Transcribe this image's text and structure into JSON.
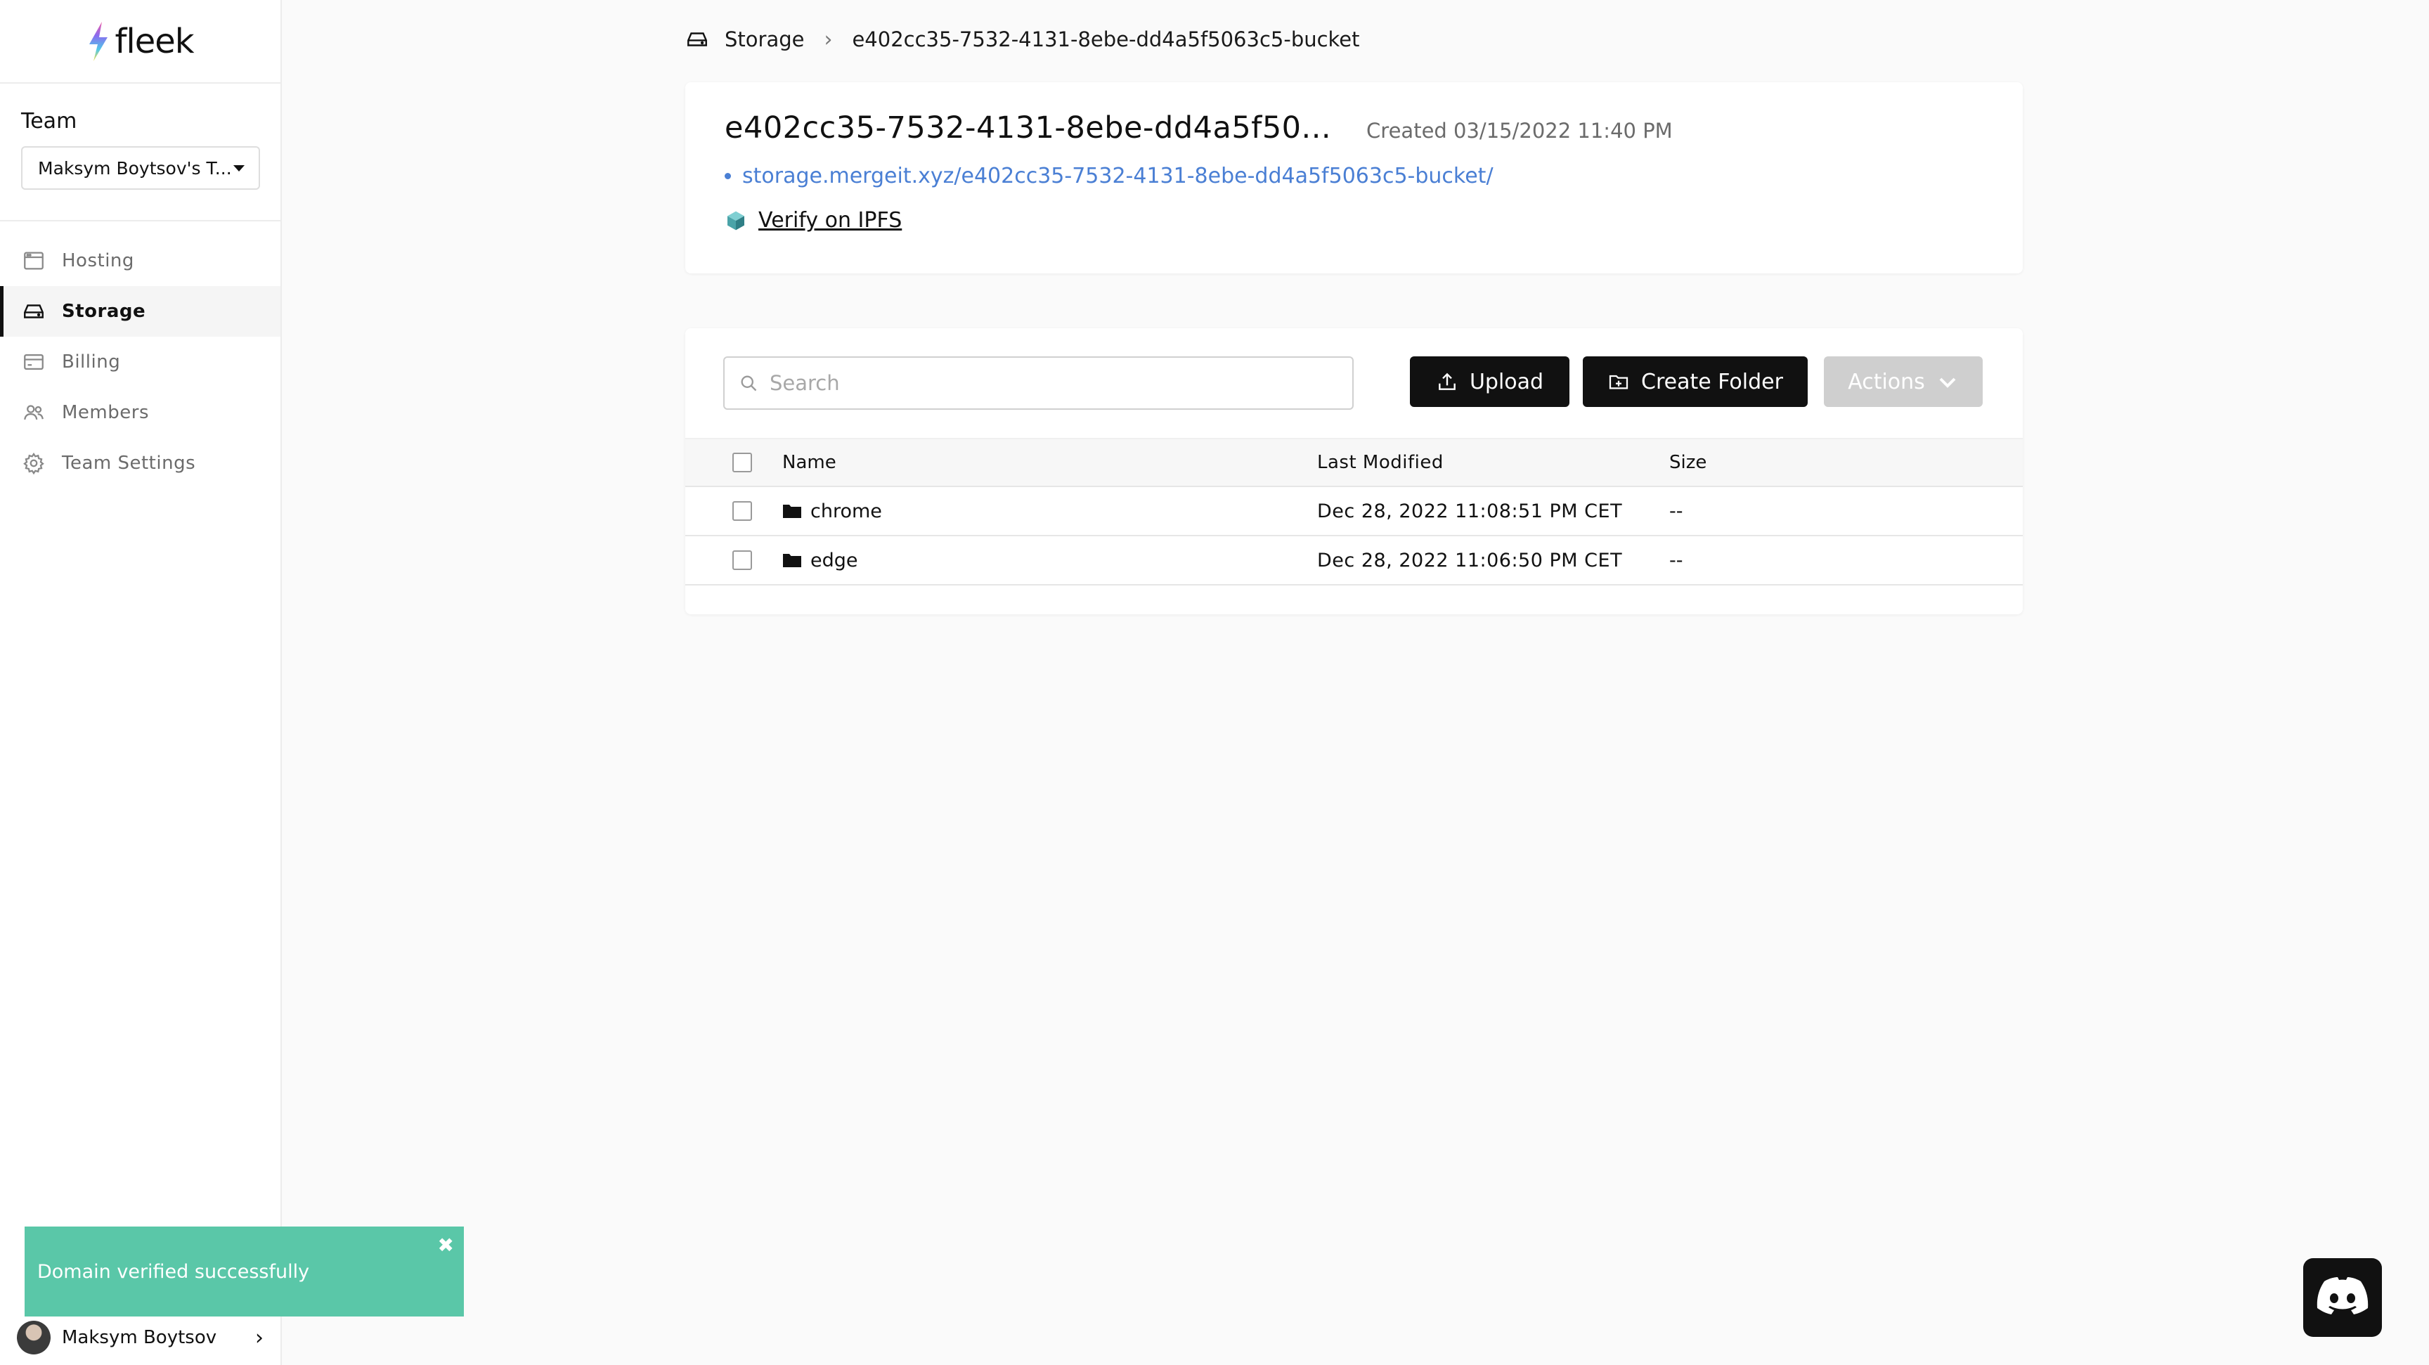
{
  "app": {
    "name": "fleek"
  },
  "sidebar": {
    "team_label": "Team",
    "team_select": "Maksym Boytsov's T...",
    "items": [
      {
        "label": "Hosting",
        "icon": "browser-window-icon",
        "active": false
      },
      {
        "label": "Storage",
        "icon": "hard-drive-icon",
        "active": true
      },
      {
        "label": "Billing",
        "icon": "credit-card-icon",
        "active": false
      },
      {
        "label": "Members",
        "icon": "users-icon",
        "active": false
      },
      {
        "label": "Team Settings",
        "icon": "gear-icon",
        "active": false
      }
    ],
    "user_name": "Maksym Boytsov"
  },
  "toast": {
    "message": "Domain verified successfully"
  },
  "breadcrumb": {
    "root": "Storage",
    "current": "e402cc35-7532-4131-8ebe-dd4a5f5063c5-bucket"
  },
  "bucket": {
    "title": "e402cc35-7532-4131-8ebe-dd4a5f50...",
    "created": "Created 03/15/2022 11:40 PM",
    "link": "storage.mergeit.xyz/e402cc35-7532-4131-8ebe-dd4a5f5063c5-bucket/",
    "verify_label": "Verify on IPFS"
  },
  "toolbar": {
    "search_placeholder": "Search",
    "upload_label": "Upload",
    "create_folder_label": "Create Folder",
    "actions_label": "Actions"
  },
  "table": {
    "headers": {
      "name": "Name",
      "modified": "Last Modified",
      "size": "Size"
    },
    "rows": [
      {
        "name": "chrome",
        "modified": "Dec 28, 2022 11:08:51 PM CET",
        "size": "--"
      },
      {
        "name": "edge",
        "modified": "Dec 28, 2022 11:06:50 PM CET",
        "size": "--"
      }
    ]
  },
  "colors": {
    "accent_link": "#4a7fd4",
    "toast_bg": "#5ac7a8",
    "primary_button": "#111111",
    "disabled_button": "#cfcfcf"
  }
}
